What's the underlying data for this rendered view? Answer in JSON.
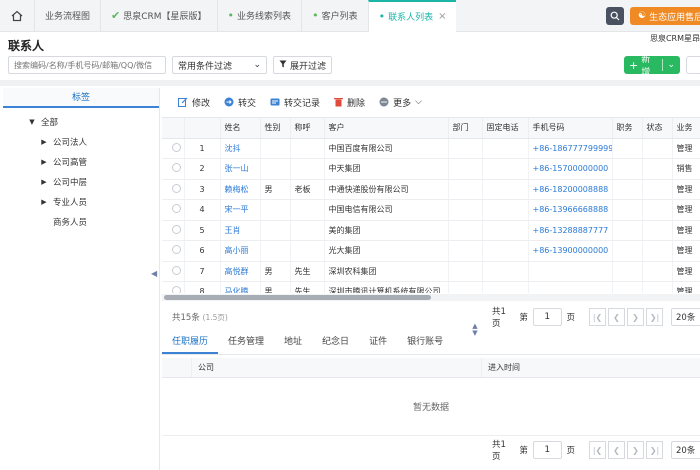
{
  "tabs": [
    {
      "label": "业务流程图",
      "dot": false,
      "closable": false
    },
    {
      "label": "思泉CRM【星辰版】",
      "dot": true,
      "closable": false
    },
    {
      "label": "业务线索列表",
      "dot": true,
      "closable": false
    },
    {
      "label": "客户列表",
      "dot": true,
      "closable": false
    },
    {
      "label": "联系人列表",
      "dot": true,
      "closable": true,
      "active": true
    }
  ],
  "top_right": {
    "eco_label": "生态应用售后"
  },
  "page": {
    "title": "联系人",
    "brand": "思泉CRM星昂"
  },
  "filters": {
    "search_placeholder": "搜索编码/名称/手机号码/邮箱/QQ/微信",
    "condition_select": "常用条件过滤",
    "expand_label": "展开过滤"
  },
  "actions": {
    "new_label": "新增"
  },
  "sidebar": {
    "header": "标签",
    "nodes": [
      {
        "label": "全部",
        "arrow": "▼",
        "indent": 24
      },
      {
        "label": "公司法人",
        "arrow": "▶",
        "indent": 36
      },
      {
        "label": "公司高管",
        "arrow": "▶",
        "indent": 36
      },
      {
        "label": "公司中层",
        "arrow": "▶",
        "indent": 36
      },
      {
        "label": "专业人员",
        "arrow": "▶",
        "indent": 36
      },
      {
        "label": "商务人员",
        "arrow": "",
        "indent": 36
      }
    ]
  },
  "toolbar": {
    "edit": "修改",
    "transfer": "转交",
    "transfer_log": "转交记录",
    "delete": "删除",
    "more": "更多"
  },
  "grid": {
    "columns": [
      "",
      "",
      "姓名",
      "性别",
      "称呼",
      "客户",
      "部门",
      "固定电话",
      "手机号码",
      "职务",
      "状态",
      "业务"
    ],
    "rows": [
      [
        "1",
        "沈抖",
        "",
        "",
        "中国百度有限公司",
        "",
        "",
        "+86-186777799999",
        "",
        "",
        "管理"
      ],
      [
        "2",
        "张一山",
        "",
        "",
        "中天集团",
        "",
        "",
        "+86-15700000000",
        "",
        "",
        "销售"
      ],
      [
        "3",
        "赖梅松",
        "男",
        "老板",
        "中通快递股份有限公司",
        "",
        "",
        "+86-18200008888",
        "",
        "",
        "管理"
      ],
      [
        "4",
        "宋一平",
        "",
        "",
        "中国电信有限公司",
        "",
        "",
        "+86-13966668888",
        "",
        "",
        "管理"
      ],
      [
        "5",
        "王肖",
        "",
        "",
        "美的集团",
        "",
        "",
        "+86-13288887777",
        "",
        "",
        "管理"
      ],
      [
        "6",
        "高小丽",
        "",
        "",
        "光大集团",
        "",
        "",
        "+86-13900000000",
        "",
        "",
        "管理"
      ],
      [
        "7",
        "高悦群",
        "男",
        "先生",
        "深圳农科集团",
        "",
        "",
        "",
        "",
        "",
        "管理"
      ],
      [
        "8",
        "马化腾",
        "男",
        "先生",
        "深圳市腾讯计算机系统有限公司",
        "",
        "",
        "",
        "",
        "",
        "管理"
      ]
    ]
  },
  "pager": {
    "total": "共15条",
    "total_sub": "(1.5页)",
    "pages_label": "共1页",
    "page_prefix": "第",
    "page_value": "1",
    "page_suffix": "页",
    "page_size": "20条"
  },
  "subtabs": [
    "任职履历",
    "任务管理",
    "地址",
    "纪念日",
    "证件",
    "银行账号"
  ],
  "subgrid": {
    "columns": [
      "公司",
      "进入时间"
    ],
    "empty": "暂无数据"
  },
  "subpager": {
    "pages_label": "共1页",
    "page_prefix": "第",
    "page_value": "1",
    "page_suffix": "页",
    "page_size": "20条"
  }
}
